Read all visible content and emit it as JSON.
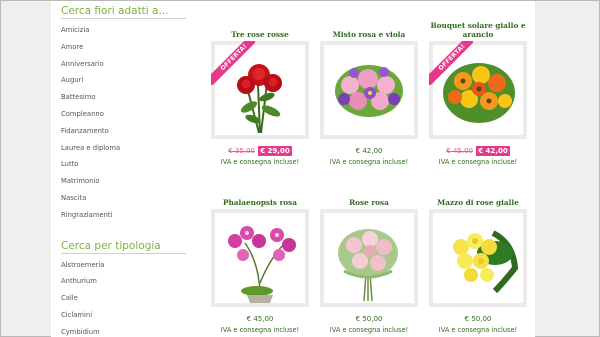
{
  "sidebar": {
    "occasions_heading": "Cerca fiori adatti a...",
    "occasions": [
      "Amicizia",
      "Amore",
      "Anniversario",
      "Auguri",
      "Battesimo",
      "Compleanno",
      "Fidanzamento",
      "Laurea e diploma",
      "Lutto",
      "Matrimonio",
      "Nascita",
      "Ringraziamenti"
    ],
    "types_heading": "Cerca per tipologia",
    "types": [
      "Alstroemeria",
      "Anthurium",
      "Calle",
      "Ciclamini",
      "Cymbidium"
    ]
  },
  "products": [
    {
      "title": "Tre rose rosse",
      "badge": "OFFERTA!",
      "old_price": "€ 35,00",
      "price": "€ 29,00",
      "note": "IVA e consegna incluse!",
      "image": "red-roses-image"
    },
    {
      "title": "Misto rosa e viola",
      "price": "€ 42,00",
      "note": "IVA e consegna incluse!",
      "image": "pink-violet-bouquet-image"
    },
    {
      "title": "Bouquet solare giallo e arancio",
      "badge": "OFFERTA!",
      "old_price": "€ 45,00",
      "price": "€ 42,00",
      "note": "IVA e consegna incluse!",
      "image": "yellow-orange-bouquet-image"
    },
    {
      "title": "Phalaenopsis rosa",
      "price": "€ 45,00",
      "note": "IVA e consegna incluse!",
      "image": "pink-orchid-image"
    },
    {
      "title": "Rose rosa",
      "price": "€ 50,00",
      "note": "IVA e consegna incluse!",
      "image": "pink-roses-image"
    },
    {
      "title": "Mazzo di rose gialle",
      "price": "€ 50,00",
      "note": "IVA e consegna incluse!",
      "image": "yellow-roses-image"
    }
  ],
  "colors": {
    "accent_green": "#7db33a",
    "title_green": "#2f6b1f",
    "offer_pink": "#e43a8c"
  }
}
